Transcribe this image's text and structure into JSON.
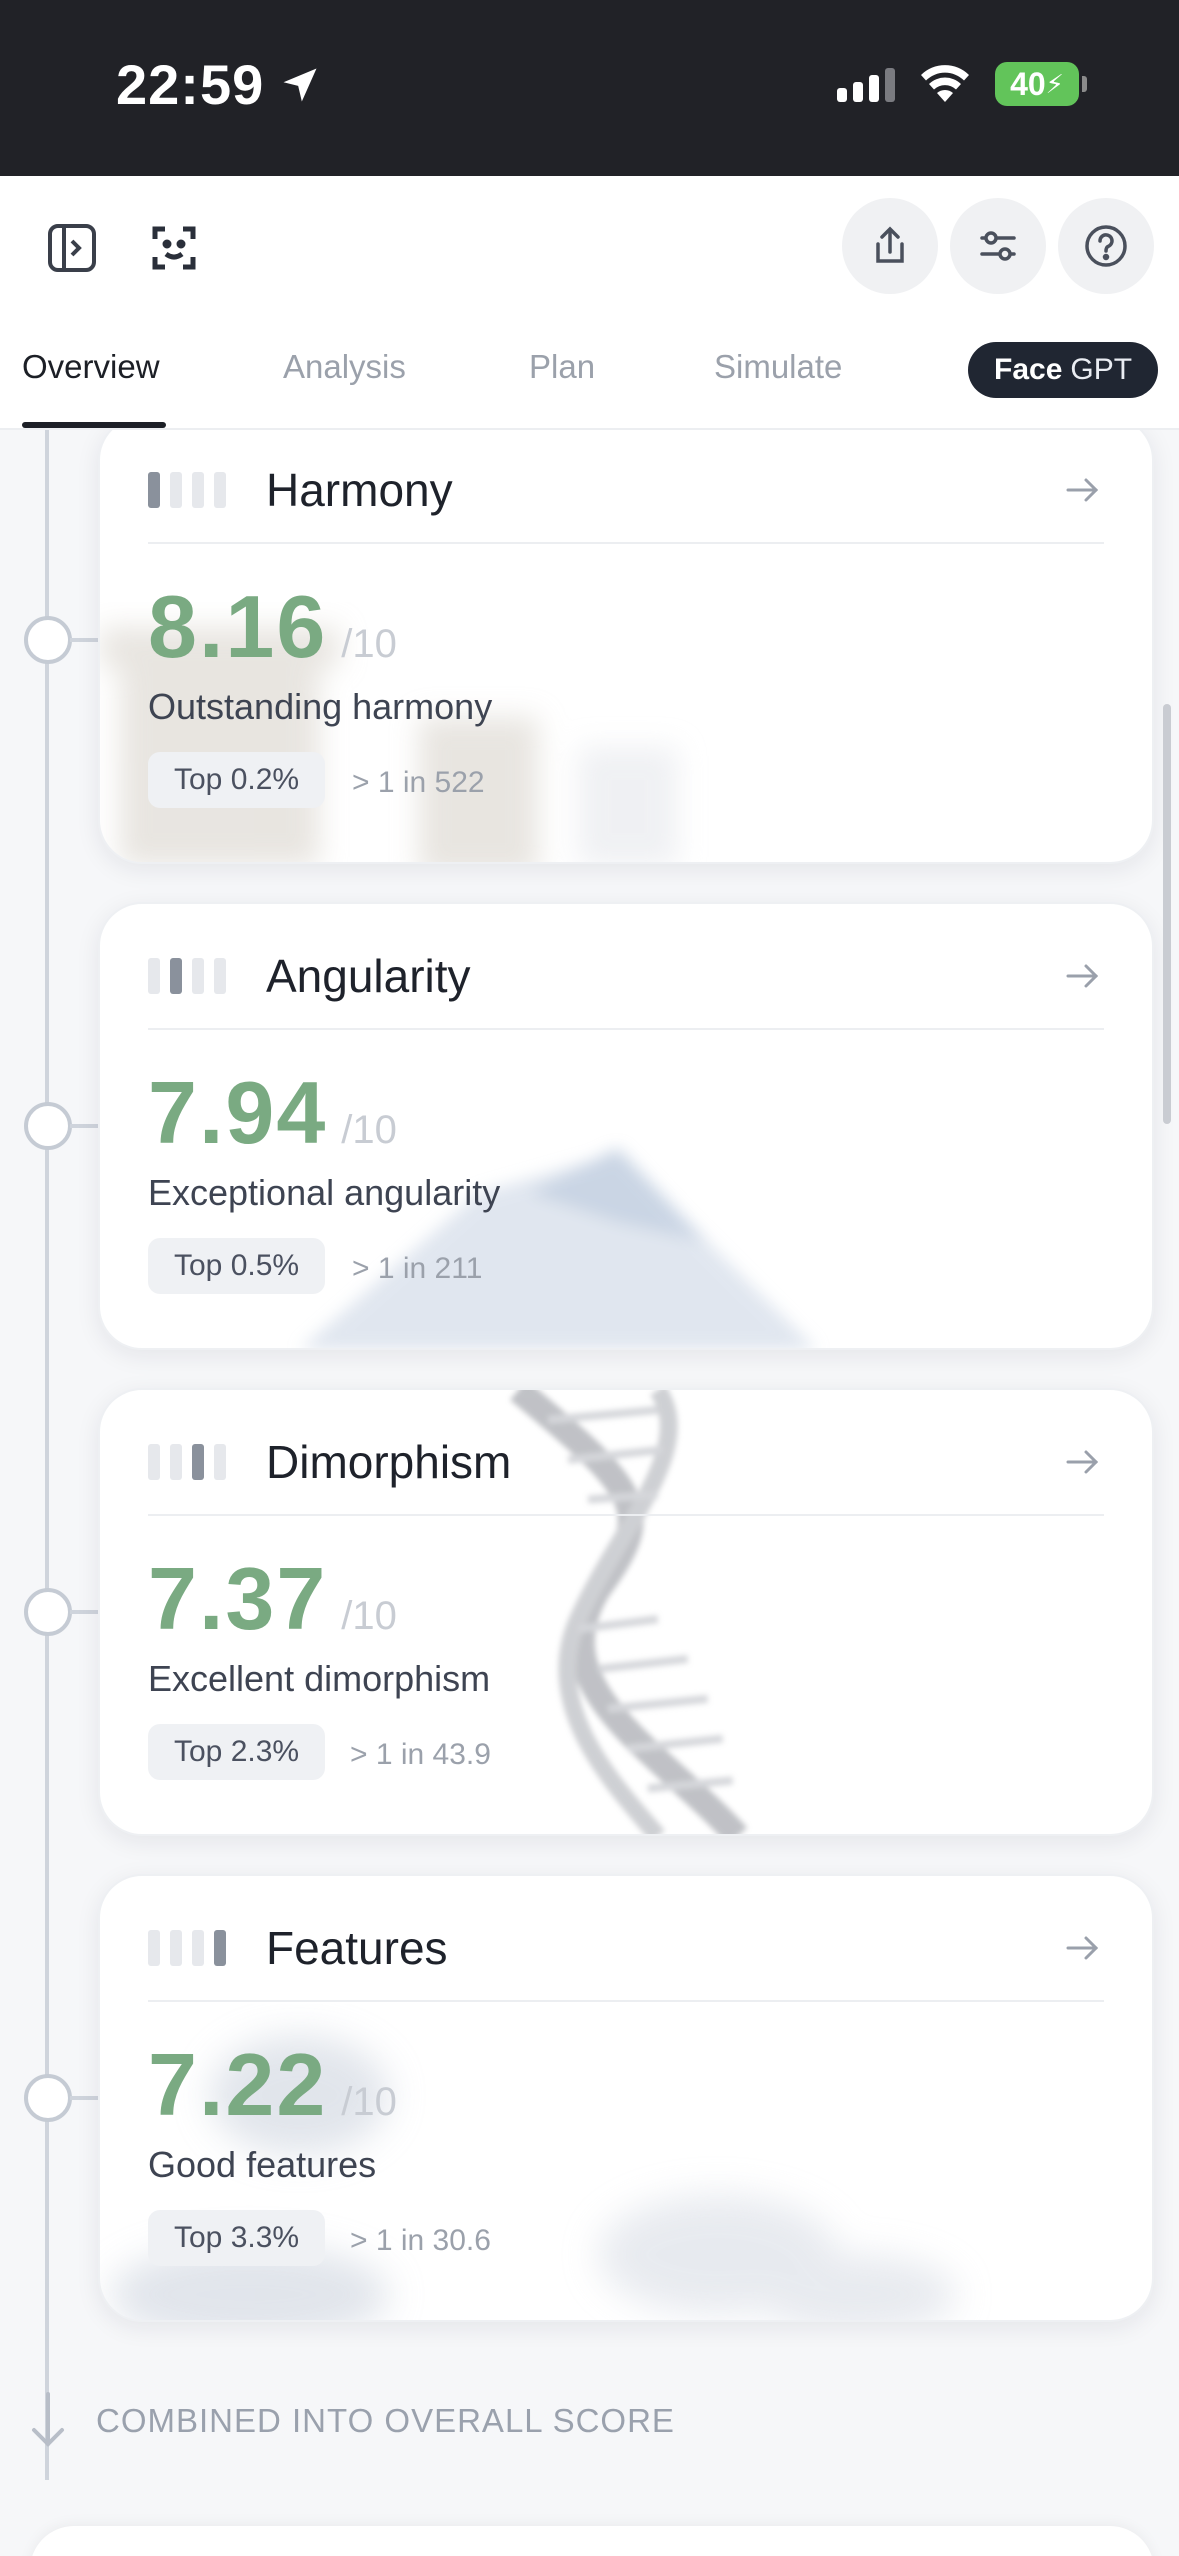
{
  "status_bar": {
    "time": "22:59",
    "battery": "40"
  },
  "toolbar": {
    "icons": [
      "sidebar-toggle-icon",
      "face-scan-icon",
      "share-icon",
      "sliders-icon",
      "help-icon"
    ]
  },
  "tabs": {
    "items": [
      "Overview",
      "Analysis",
      "Plan",
      "Simulate"
    ],
    "active": "Overview",
    "facegpt_bold": "Face",
    "facegpt_light": "GPT"
  },
  "cards": [
    {
      "title": "Harmony",
      "level": 1,
      "score": "8.16",
      "max": "/10",
      "description": "Outstanding harmony",
      "top": "Top 0.2%",
      "rarity": "> 1 in 522"
    },
    {
      "title": "Angularity",
      "level": 2,
      "score": "7.94",
      "max": "/10",
      "description": "Exceptional angularity",
      "top": "Top 0.5%",
      "rarity": "> 1 in 211"
    },
    {
      "title": "Dimorphism",
      "level": 3,
      "score": "7.37",
      "max": "/10",
      "description": "Excellent dimorphism",
      "top": "Top 2.3%",
      "rarity": "> 1 in 43.9"
    },
    {
      "title": "Features",
      "level": 4,
      "score": "7.22",
      "max": "/10",
      "description": "Good features",
      "top": "Top 3.3%",
      "rarity": "> 1 in 30.6"
    }
  ],
  "footer": {
    "combined_label": "COMBINED INTO OVERALL SCORE"
  },
  "colors": {
    "score_green": "#7aaa82",
    "status_bg": "#212227",
    "facegpt_bg": "#202632",
    "battery_green": "#62c45a"
  }
}
